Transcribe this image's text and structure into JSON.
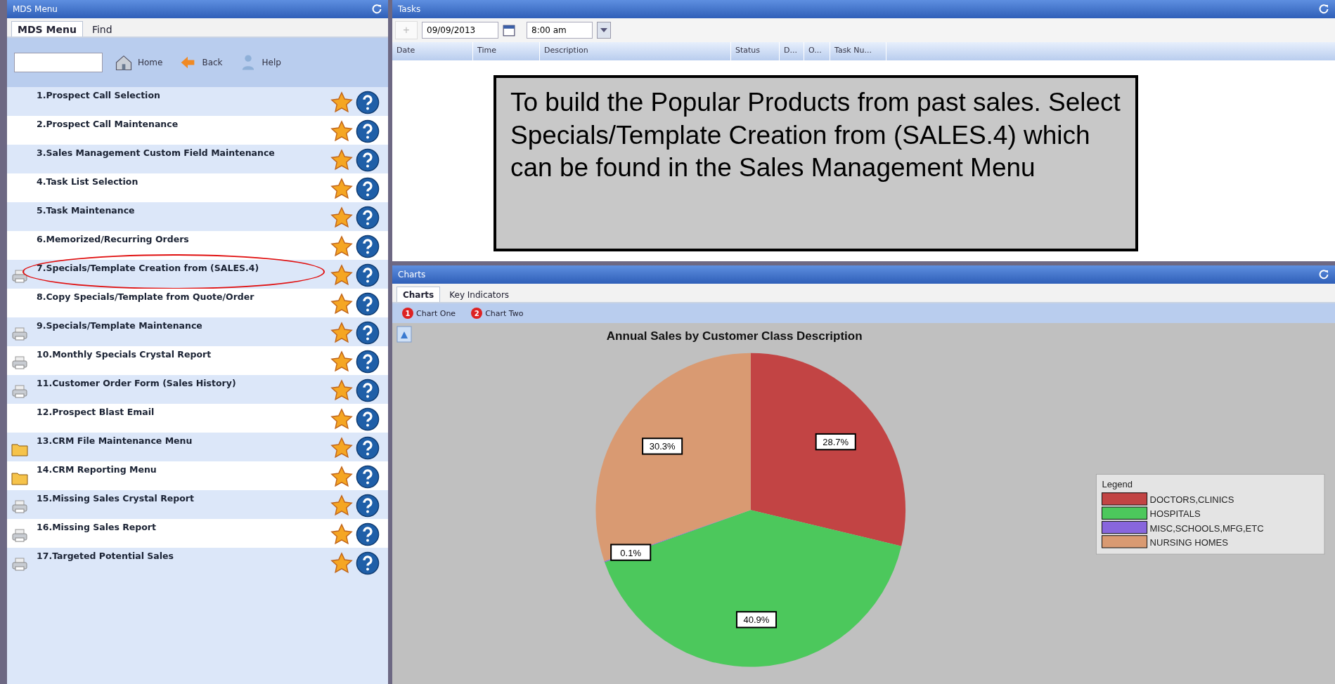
{
  "menu_panel": {
    "title": "MDS Menu",
    "tabs": [
      {
        "label": "MDS Menu",
        "selected": true
      },
      {
        "label": "Find",
        "selected": false
      }
    ],
    "toolbar": {
      "buttons": [
        "Home",
        "Back",
        "Help"
      ]
    },
    "items": [
      {
        "label": "1.Prospect Call Selection",
        "kind": "program",
        "circled": false
      },
      {
        "label": "2.Prospect Call Maintenance",
        "kind": "program",
        "circled": false
      },
      {
        "label": "3.Sales Management Custom Field Maintenance",
        "kind": "program",
        "circled": false
      },
      {
        "label": "4.Task List Selection",
        "kind": "program",
        "circled": false
      },
      {
        "label": "5.Task Maintenance",
        "kind": "program",
        "circled": false
      },
      {
        "label": "6.Memorized/Recurring Orders",
        "kind": "program",
        "circled": false
      },
      {
        "label": "7.Specials/Template Creation from (SALES.4)",
        "kind": "report",
        "circled": true
      },
      {
        "label": "8.Copy Specials/Template from Quote/Order",
        "kind": "program",
        "circled": false
      },
      {
        "label": "9.Specials/Template Maintenance",
        "kind": "report",
        "circled": false
      },
      {
        "label": "10.Monthly Specials Crystal Report",
        "kind": "report",
        "circled": false
      },
      {
        "label": "11.Customer Order Form (Sales History)",
        "kind": "report",
        "circled": false
      },
      {
        "label": "12.Prospect Blast Email",
        "kind": "program",
        "circled": false
      },
      {
        "label": "13.CRM File Maintenance Menu",
        "kind": "menu",
        "circled": false
      },
      {
        "label": "14.CRM Reporting Menu",
        "kind": "menu",
        "circled": false
      },
      {
        "label": "15.Missing Sales Crystal Report",
        "kind": "report",
        "circled": false
      },
      {
        "label": "16.Missing Sales Report",
        "kind": "report",
        "circled": false
      },
      {
        "label": "17.Targeted Potential Sales",
        "kind": "report",
        "circled": false
      }
    ]
  },
  "tasks_panel": {
    "title": "Tasks",
    "add_button": "+",
    "date": "09/09/2013",
    "time": "8:00 am",
    "columns": [
      "Date",
      "Time",
      "Description",
      "Status",
      "D...",
      "O...",
      "Task Nu..."
    ]
  },
  "callout": "To build the Popular Products from past sales. Select Specials/Template Creation from (SALES.4) which can be found in the Sales Management Menu",
  "charts_panel": {
    "title": "Charts",
    "tabs": [
      {
        "label": "Charts",
        "selected": true
      },
      {
        "label": "Key Indicators",
        "selected": false
      }
    ],
    "toolbar": [
      {
        "badge": "1",
        "label": "Chart One"
      },
      {
        "badge": "2",
        "label": "Chart Two"
      }
    ],
    "chart_data": {
      "type": "pie",
      "title": "Annual Sales by Customer Class Description",
      "categories": [
        "DOCTORS,CLINICS",
        "HOSPITALS",
        "MISC,SCHOOLS,MFG,ETC",
        "NURSING HOMES"
      ],
      "values": [
        28.7,
        40.9,
        0.1,
        30.3
      ],
      "value_labels": [
        "28.7%",
        "40.9%",
        "0.1%",
        "30.3%"
      ],
      "legend": "right"
    },
    "legend": {
      "title": "Legend",
      "items": [
        {
          "color": "#c24444"
        },
        {
          "color": "#4cc85c"
        },
        {
          "color": "#8866dd"
        },
        {
          "color": "#d99a72"
        }
      ]
    }
  }
}
